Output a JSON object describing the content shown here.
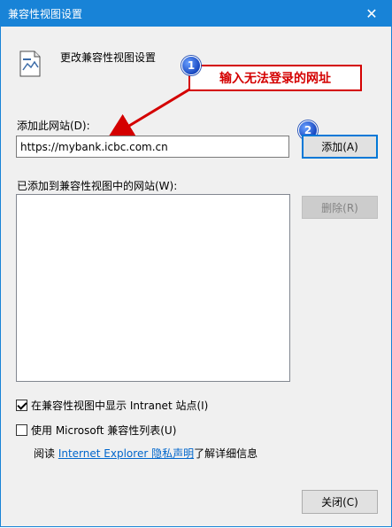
{
  "window": {
    "title": "兼容性视图设置",
    "close_glyph": "✕"
  },
  "header": {
    "text": "更改兼容性视图设置",
    "icon": "settings-page-icon"
  },
  "annotations": {
    "callout_text": "输入无法登录的网址",
    "step1": "1",
    "step2": "2",
    "callout_color": "#d40000",
    "badge_color": "#1848c0"
  },
  "add_site": {
    "label": "添加此网站(D):",
    "value": "https://mybank.icbc.com.cn",
    "add_button": "添加(A)"
  },
  "site_list": {
    "label": "已添加到兼容性视图中的网站(W):",
    "items": [],
    "remove_button": "删除(R)"
  },
  "options": {
    "show_intranet": {
      "label": "在兼容性视图中显示 Intranet 站点(I)",
      "checked": true
    },
    "use_ms_list": {
      "label": "使用 Microsoft 兼容性列表(U)",
      "checked": false
    }
  },
  "privacy": {
    "prefix": "阅读 ",
    "link": "Internet Explorer 隐私声明",
    "suffix": "了解详细信息"
  },
  "footer": {
    "close_button": "关闭(C)"
  },
  "colors": {
    "titlebar": "#1883d7",
    "link": "#0066cc",
    "window_bg": "#f0f0f0"
  }
}
